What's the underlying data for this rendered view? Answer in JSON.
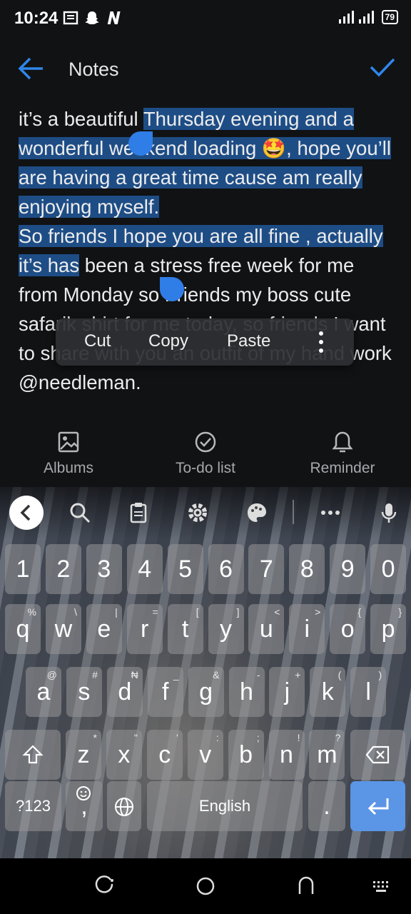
{
  "status": {
    "time": "10:24",
    "battery": "79"
  },
  "header": {
    "title": "Notes"
  },
  "note": {
    "pre": "it’s a beautiful ",
    "selected": "Thursday evening and a wonderful weekend loading 🤩, hope you’ll are having a great time cause am really enjoying myself.\nSo friends I hope you are all fine , actually it’s has",
    "post": " been a stress free week for me from Monday so Friends my boss cute safarik shirt for me today, so friends I want to share with you an outfit of my hand work @needleman."
  },
  "context_menu": {
    "cut": "Cut",
    "copy": "Copy",
    "paste": "Paste"
  },
  "toolbar": {
    "albums": "Albums",
    "todo": "To-do list",
    "reminder": "Reminder"
  },
  "keyboard": {
    "numbers": [
      "1",
      "2",
      "3",
      "4",
      "5",
      "6",
      "7",
      "8",
      "9",
      "0"
    ],
    "row1": [
      "q",
      "w",
      "e",
      "r",
      "t",
      "y",
      "u",
      "i",
      "o",
      "p"
    ],
    "row1_hints": [
      "%",
      "\\",
      "|",
      "=",
      "[",
      "]",
      "<",
      ">",
      "{",
      "}"
    ],
    "row2": [
      "a",
      "s",
      "d",
      "f",
      "g",
      "h",
      "j",
      "k",
      "l"
    ],
    "row2_hints": [
      "@",
      "#",
      "₦",
      "_",
      "&",
      "-",
      "+",
      "(",
      ")"
    ],
    "row3": [
      "z",
      "x",
      "c",
      "v",
      "b",
      "n",
      "m"
    ],
    "row3_hints": [
      "*",
      "\"",
      "'",
      ":",
      ";",
      "!",
      "?"
    ],
    "symbols_label": "?123",
    "comma": ",",
    "space_label": "English",
    "period": "."
  }
}
